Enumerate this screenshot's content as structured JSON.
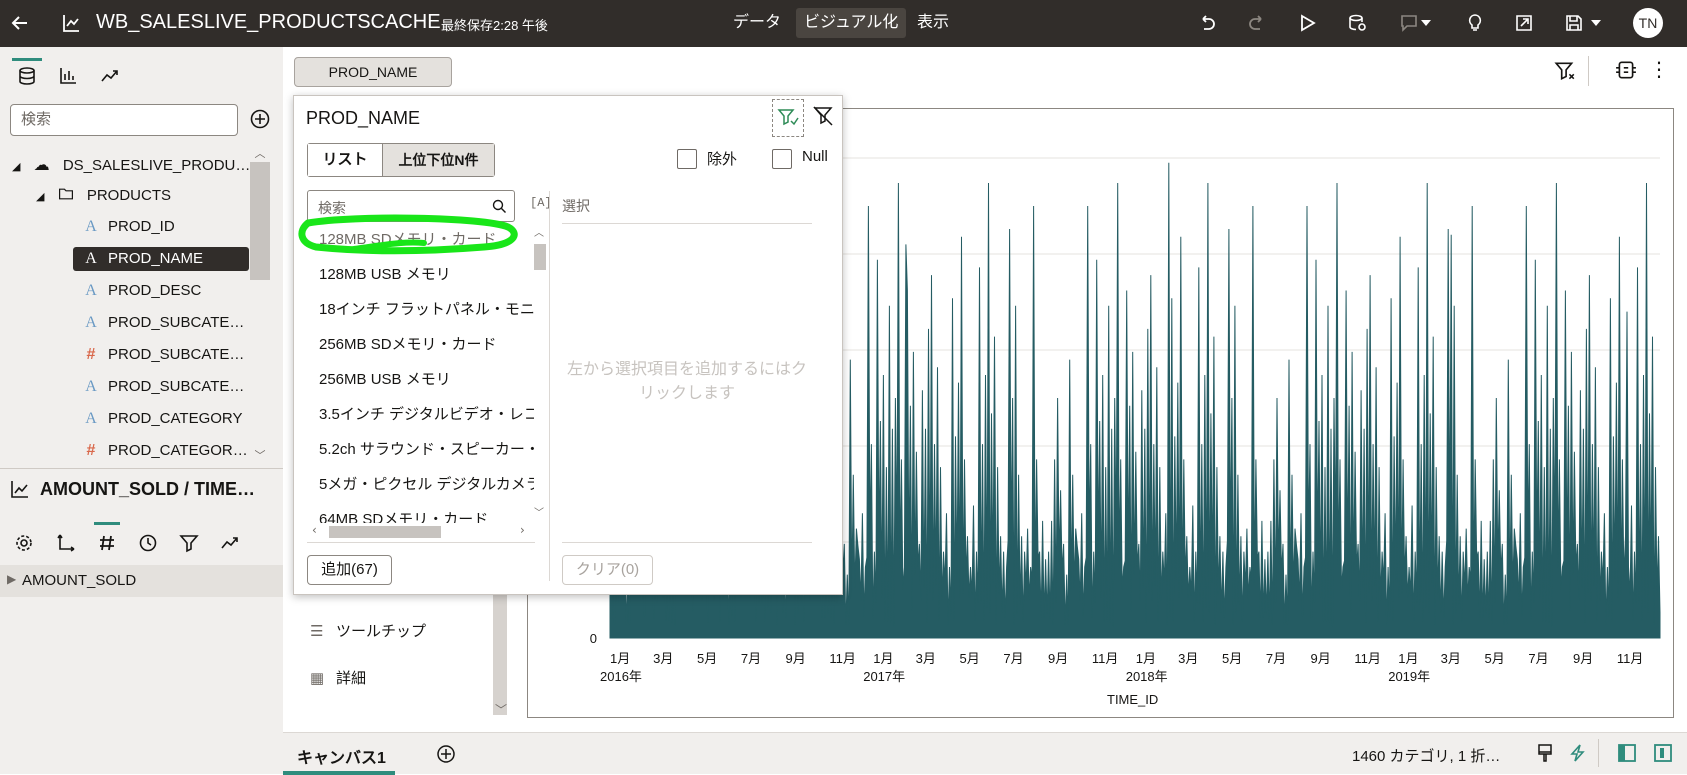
{
  "header": {
    "title": "WB_SALESLIVE_PRODUCTSCACHE",
    "last_saved": "最終保存2:28 午後",
    "menu": [
      "データ",
      "ビジュアル化",
      "表示"
    ],
    "avatar": "TN"
  },
  "left_panel": {
    "search_placeholder": "検索",
    "tree": {
      "datasource": "DS_SALESLIVE_PRODU…",
      "folder": "PRODUCTS",
      "columns": [
        {
          "label": "PROD_ID",
          "type": "attribute"
        },
        {
          "label": "PROD_NAME",
          "type": "attribute",
          "selected": true
        },
        {
          "label": "PROD_DESC",
          "type": "attribute"
        },
        {
          "label": "PROD_SUBCATE…",
          "type": "attribute"
        },
        {
          "label": "PROD_SUBCATE…",
          "type": "measure"
        },
        {
          "label": "PROD_SUBCATE…",
          "type": "attribute"
        },
        {
          "label": "PROD_CATEGORY",
          "type": "attribute"
        },
        {
          "label": "PROD_CATEGOR…",
          "type": "measure"
        }
      ]
    },
    "viz_title": "AMOUNT_SOLD / TIME…",
    "grammar_item": "AMOUNT_SOLD",
    "behind_items": [
      "ツールチップ",
      "詳細"
    ]
  },
  "canvas": {
    "filter_chip": "PROD_NAME",
    "tab": "キャンバス1",
    "status": "1460 カテゴリ, 1 折…"
  },
  "filter_popup": {
    "title": "PROD_NAME",
    "tabs": [
      "リスト",
      "上位下位N件"
    ],
    "exclude_label": "除外",
    "null_label": "Null",
    "search_placeholder": "検索",
    "selected_header": "選択",
    "empty_hint": "左から選択項目を追加するにはクリックします",
    "items": [
      "128MB SDメモリ・カード",
      "128MB USB メモリ",
      "18インチ フラットパネル・モニ",
      "256MB SDメモリ・カード",
      "256MB USB メモリ",
      "3.5インチ デジタルビデオ・レコ",
      "5.2ch サラウンド・スピーカー・",
      "5メガ・ピクセル デジタルカメラ",
      "64MB SDメモリ・カード"
    ],
    "add_button": "追加(67)",
    "clear_button": "クリア(0)"
  },
  "colors": {
    "topbar": "#312d2a",
    "series": "#255c63",
    "highlight": "#19e619"
  },
  "chart_data": {
    "type": "line",
    "xlabel": "TIME_ID",
    "ylabel": "",
    "y_tick_visible": "0",
    "x_range": [
      "2016-01-01",
      "2019-12-31"
    ],
    "month_ticks": [
      "1月",
      "3月",
      "5月",
      "7月",
      "9月",
      "11月",
      "1月",
      "3月",
      "5月",
      "7月",
      "9月",
      "11月",
      "1月",
      "3月",
      "5月",
      "7月",
      "9月",
      "11月",
      "1月",
      "3月",
      "5月",
      "7月",
      "9月",
      "11月"
    ],
    "year_labels": [
      "2016年",
      "2017年",
      "2018年",
      "2019年"
    ],
    "series": [
      {
        "values": [
          0.1,
          0.06,
          0.14,
          0.08,
          0.22,
          0.12,
          0.3,
          0.09,
          0.18,
          0.4,
          0.11,
          0.25,
          0.07,
          0.16,
          0.35,
          0.1,
          0.2,
          0.62,
          0.13,
          0.28,
          0.09,
          0.45,
          0.15,
          0.32,
          0.08,
          0.19,
          0.55,
          0.12,
          0.24,
          0.38,
          0.1,
          0.17,
          0.48,
          0.09,
          0.27,
          0.14,
          0.33,
          0.08,
          0.21,
          0.12,
          0.42,
          0.1,
          0.26,
          0.11,
          0.3,
          0.09,
          0.58,
          0.13,
          0.22,
          0.35,
          0.08,
          0.18,
          0.44,
          0.12,
          0.29,
          0.1,
          0.36,
          0.09,
          0.23,
          0.5,
          0.11,
          0.2,
          0.31,
          0.08,
          0.26,
          0.14,
          0.39,
          0.1,
          0.46,
          0.12,
          0.24,
          0.09,
          0.34,
          0.13,
          0.21,
          0.53,
          0.1,
          0.28,
          0.15,
          0.37,
          0.08,
          0.19,
          0.43,
          0.11,
          0.25,
          0.1,
          0.32,
          0.14,
          0.51,
          0.09,
          0.22,
          0.3,
          0.12,
          0.4,
          0.08,
          0.27,
          0.16,
          0.35,
          0.1,
          0.19,
          0.47,
          0.09,
          0.24,
          0.13,
          0.33,
          0.11,
          0.58,
          0.1,
          0.28,
          0.15,
          0.38,
          0.09,
          0.21,
          0.45,
          0.12,
          0.26,
          0.1,
          0.34,
          0.08,
          0.23,
          0.52,
          0.11,
          0.3,
          0.14,
          0.42,
          0.09,
          0.2,
          0.36,
          0.12,
          0.27,
          0.1,
          0.44,
          0.13,
          0.25,
          0.08,
          0.32,
          0.55,
          0.11,
          0.22,
          0.38,
          0.1,
          0.29,
          0.14,
          0.48,
          0.09,
          0.21
        ],
        "peaks": [
          {
            "date": "2017-02",
            "value": 0.82
          },
          {
            "date": "2018-02",
            "value": 0.99
          },
          {
            "date": "2019-03",
            "value": 0.84
          },
          {
            "date": "2019-11",
            "value": 0.68
          }
        ]
      }
    ]
  }
}
